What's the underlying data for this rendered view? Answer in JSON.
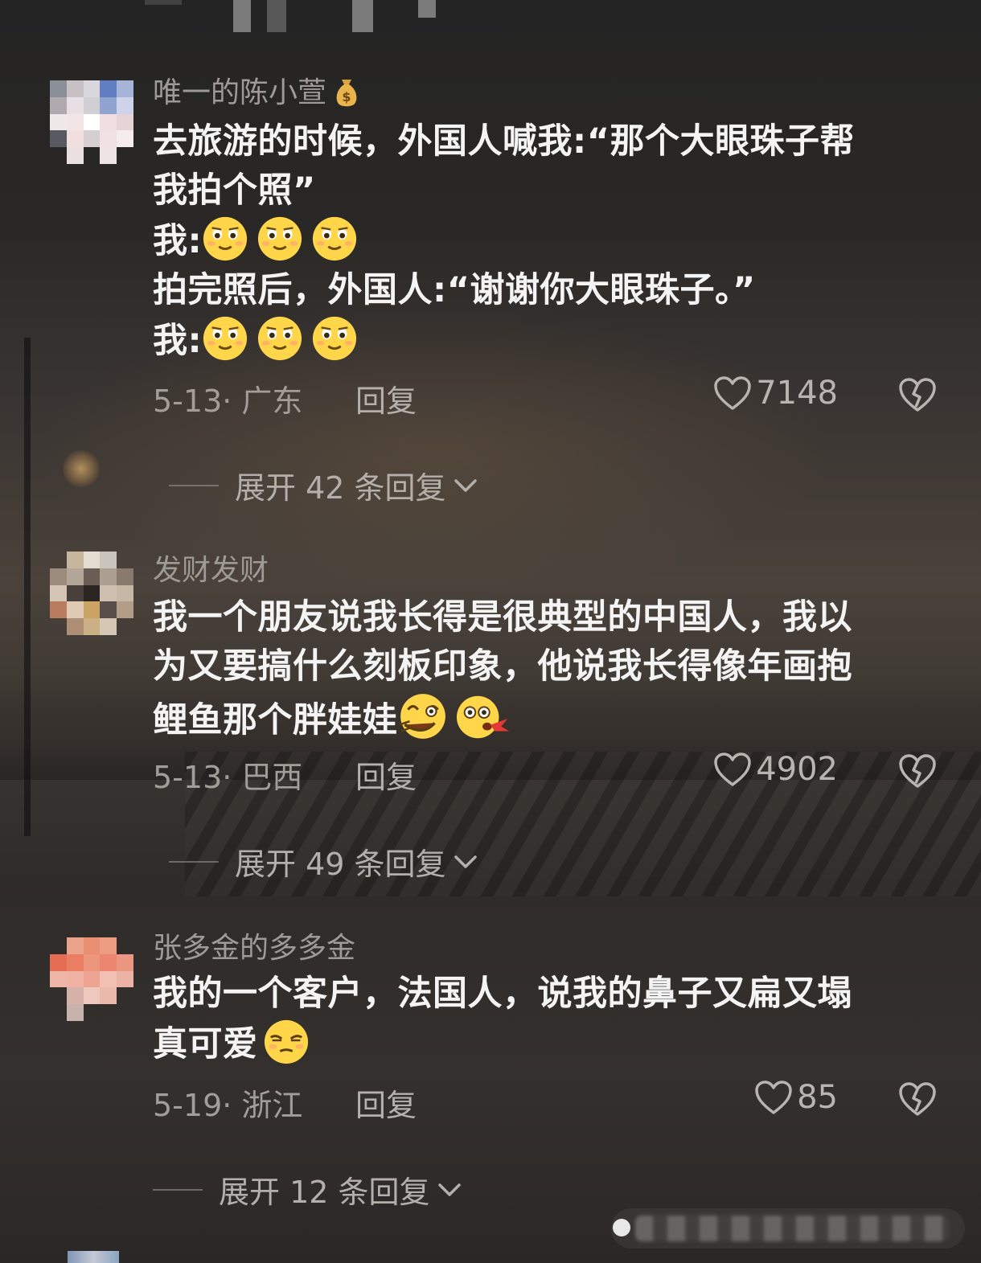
{
  "comments": [
    {
      "username": "唯一的陈小萱",
      "badge": "money-bag-icon",
      "lines": [
        "去旅游的时候，外国人喊我:“那个大眼珠子帮",
        "我拍个照”",
        "我:",
        "拍完照后，外国人:“谢谢你大眼珠子。”",
        "我:"
      ],
      "emoji_names": [
        "squint-smile-emoji",
        "squint-smile-emoji",
        "squint-smile-emoji"
      ],
      "date": "5-13",
      "location": "广东",
      "reply_label": "回复",
      "likes": "7148",
      "expand_label": "展开 42 条回复"
    },
    {
      "username": "发财发财",
      "lines": [
        "我一个朋友说我长得是很典型的中国人，我以",
        "为又要搞什么刻板印象，他说我长得像年画抱",
        "鲤鱼那个胖娃娃"
      ],
      "emoji_names": [
        "dizzy-laugh-emoji",
        "spit-blood-emoji"
      ],
      "date": "5-13",
      "location": "巴西",
      "reply_label": "回复",
      "likes": "4902",
      "expand_label": "展开 49 条回复"
    },
    {
      "username": "张多金的多多金",
      "lines": [
        "我的一个客户，法国人，说我的鼻子又扁又塌",
        "真可爱"
      ],
      "emoji_names": [
        "smug-emoji"
      ],
      "date": "5-19",
      "location": "浙江",
      "reply_label": "回复",
      "likes": "85",
      "expand_label": "展开 12 条回复"
    }
  ],
  "colors": {
    "username": "#9e9a96",
    "body": "#f4f4f4",
    "meta": "#a29d98",
    "emoji_face": "#ffd54a"
  }
}
